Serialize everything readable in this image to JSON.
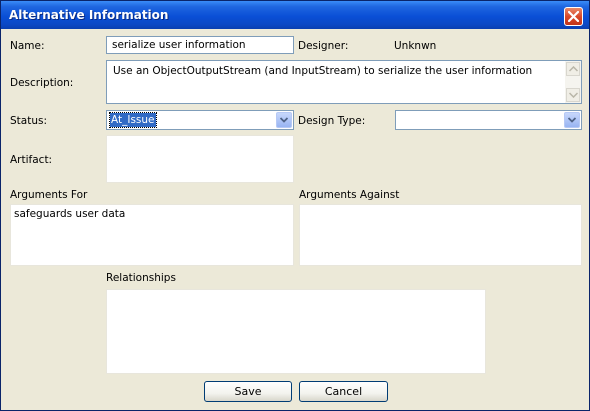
{
  "window": {
    "title": "Alternative Information"
  },
  "form": {
    "name_label": "Name:",
    "name_value": "serialize user information",
    "designer_label": "Designer:",
    "designer_value": "Unknwn",
    "description_label": "Description:",
    "description_value": "Use an ObjectOutputStream (and InputStream) to serialize the user information",
    "status_label": "Status:",
    "status_value": "At_Issue",
    "design_type_label": "Design Type:",
    "design_type_value": "",
    "artifact_label": "Artifact:",
    "artifact_value": "",
    "arguments_for_label": "Arguments For",
    "arguments_for_items": [
      "safeguards user data"
    ],
    "arguments_against_label": "Arguments Against",
    "arguments_against_items": [],
    "relationships_label": "Relationships"
  },
  "buttons": {
    "save": "Save",
    "cancel": "Cancel"
  },
  "icons": {
    "close": "close-icon",
    "scroll_up": "arrow-up-icon",
    "scroll_down": "arrow-down-icon",
    "dropdown": "chevron-down-icon"
  },
  "colors": {
    "titlebar": "#0a4fd6",
    "dialog_bg": "#ece9d8",
    "selection": "#316ac5",
    "close_button": "#d9482a"
  }
}
